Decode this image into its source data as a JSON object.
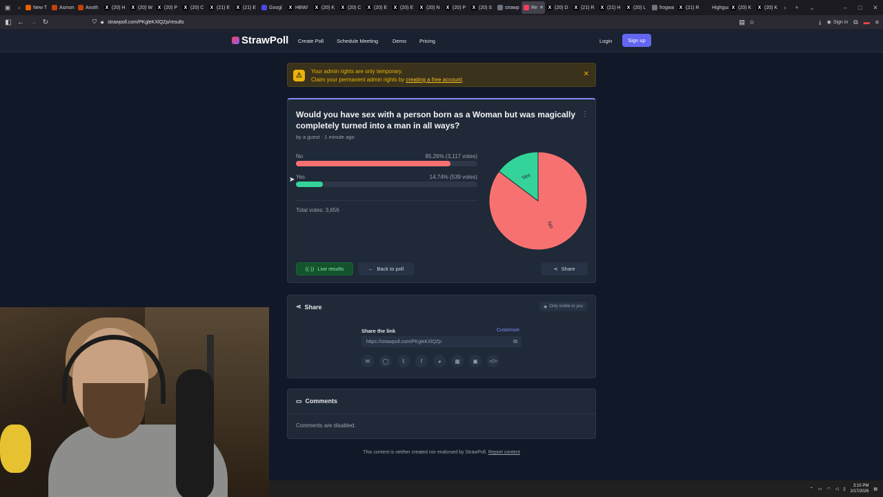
{
  "browser": {
    "tabs": [
      {
        "label": "New T",
        "icon": "firefox-icon",
        "color": "#e66000"
      },
      {
        "label": "Asmon",
        "icon": "asmon-icon",
        "color": "#c2410c"
      },
      {
        "label": "Anoth",
        "icon": "asmon-icon",
        "color": "#c2410c"
      },
      {
        "label": "(20) H",
        "icon": "x-icon",
        "color": "#000000"
      },
      {
        "label": "(20) W",
        "icon": "x-icon",
        "color": "#000000"
      },
      {
        "label": "(20) P",
        "icon": "x-icon",
        "color": "#000000"
      },
      {
        "label": "(20) C",
        "icon": "x-icon",
        "color": "#000000"
      },
      {
        "label": "(21) E",
        "icon": "x-icon",
        "color": "#000000"
      },
      {
        "label": "(21) E",
        "icon": "x-icon",
        "color": "#000000"
      },
      {
        "label": "Googl",
        "icon": "gemini-icon",
        "color": "#4f46e5"
      },
      {
        "label": "HBW/",
        "icon": "x-icon",
        "color": "#000000"
      },
      {
        "label": "(20) K",
        "icon": "x-icon",
        "color": "#000000"
      },
      {
        "label": "(20) C",
        "icon": "x-icon",
        "color": "#000000"
      },
      {
        "label": "(20) E",
        "icon": "x-icon",
        "color": "#000000"
      },
      {
        "label": "(20) E",
        "icon": "x-icon",
        "color": "#000000"
      },
      {
        "label": "(20) N",
        "icon": "x-icon",
        "color": "#000000"
      },
      {
        "label": "(20) P",
        "icon": "x-icon",
        "color": "#000000"
      },
      {
        "label": "(20) S",
        "icon": "x-icon",
        "color": "#000000"
      },
      {
        "label": "strawp",
        "icon": "strawpoll-icon",
        "color": "#6b7280"
      },
      {
        "label": "Re",
        "icon": "strawpoll-icon",
        "color": "#f43f5e",
        "active": true
      },
      {
        "label": "(20) D",
        "icon": "x-icon",
        "color": "#000000"
      },
      {
        "label": "(21) R",
        "icon": "x-icon",
        "color": "#000000"
      },
      {
        "label": "(21) H",
        "icon": "x-icon",
        "color": "#000000"
      },
      {
        "label": "(20) L",
        "icon": "x-icon",
        "color": "#000000"
      },
      {
        "label": "frogwa",
        "icon": "globe-icon",
        "color": "#6b7280"
      },
      {
        "label": "(21) R",
        "icon": "x-icon",
        "color": "#000000"
      },
      {
        "label": "Highguar",
        "icon": "none",
        "color": "#1c1b22"
      },
      {
        "label": "(20) K",
        "icon": "x-icon",
        "color": "#000000"
      },
      {
        "label": "(20) K",
        "icon": "x-icon",
        "color": "#000000"
      }
    ],
    "url": "strawpoll.com/PKgleKXlQZp/results",
    "sign_in": "Sign in"
  },
  "site": {
    "brand": "StrawPoll",
    "nav": [
      "Create Poll",
      "Schedule Meeting",
      "Demo",
      "Pricing"
    ],
    "login": "Login",
    "signup": "Sign up"
  },
  "alert": {
    "line1": "Your admin rights are only temporary.",
    "line2_prefix": "Claim your permanent admin rights by ",
    "line2_link": "creating a free account",
    "line2_suffix": "."
  },
  "poll": {
    "question": "Would you have sex with a person born as a Woman but was magically completely turned into a man in all ways?",
    "byline": "by a guest · 1 minute ago",
    "options": [
      {
        "label": "No",
        "result": "85.26% (3,117 votes)",
        "fraction": 0.8526,
        "color": "#f87171"
      },
      {
        "label": "Yes",
        "result": "14.74% (539 votes)",
        "fraction": 0.1474,
        "color": "#34d399"
      }
    ],
    "total": "Total votes: 3,656",
    "buttons": {
      "live": "Live results",
      "back": "Back to poll",
      "share": "Share"
    }
  },
  "chart_data": {
    "type": "pie",
    "categories": [
      "No",
      "Yes"
    ],
    "values": [
      85.26,
      14.74
    ],
    "colors": [
      "#f87171",
      "#34d399"
    ]
  },
  "share": {
    "title": "Share",
    "visibility": "Only visible to you",
    "link_label": "Share the link",
    "customize": "Customize",
    "link": "https://strawpoll.com/PKgleKXlQZp",
    "socials": [
      "email-icon",
      "whatsapp-icon",
      "twitter-icon",
      "facebook-icon",
      "reddit-icon",
      "qr-code-icon",
      "embed-box-icon",
      "code-icon"
    ]
  },
  "comments": {
    "title": "Comments",
    "status": "Comments are disabled."
  },
  "footer": {
    "text": "This content is neither created nor endorsed by StrawPoll.",
    "report": "Report content"
  },
  "taskbar": {
    "time": "3:10 PM",
    "date": "2/17/2026"
  }
}
